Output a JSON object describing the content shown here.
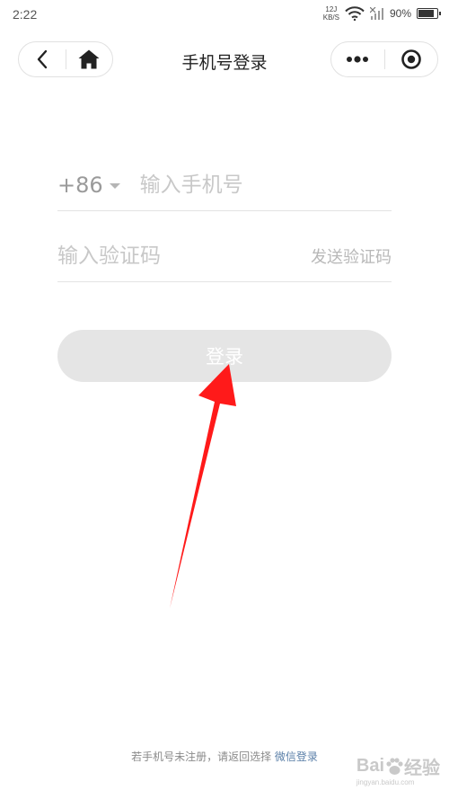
{
  "status_bar": {
    "time": "2:22",
    "net_speed_value": "12J",
    "net_speed_unit": "KB/S",
    "battery_text": "90%",
    "battery_level": 0.9
  },
  "nav": {
    "title": "手机号登录"
  },
  "form": {
    "country_code": "+86",
    "phone_placeholder": "输入手机号",
    "code_placeholder": "输入验证码",
    "send_code_label": "发送验证码",
    "login_label": "登录"
  },
  "footer": {
    "note": "若手机号未注册，请返回选择",
    "wechat_login_label": "微信登录"
  },
  "watermark": {
    "brand_a": "Bai",
    "brand_b": "经验",
    "site": "jingyan.baidu.com"
  },
  "colors": {
    "arrow": "#ff1a1a",
    "button_bg": "#e5e5e5",
    "link": "#5a7fa8"
  }
}
